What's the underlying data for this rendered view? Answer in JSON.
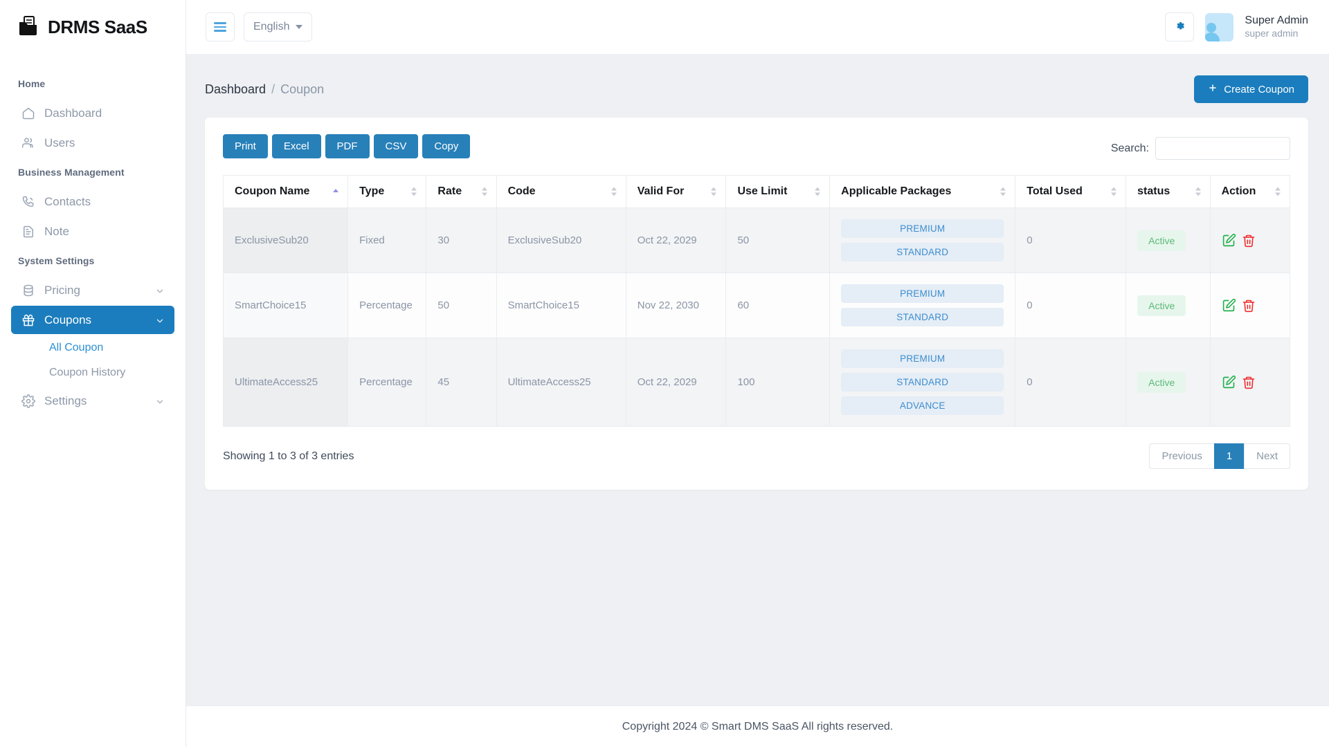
{
  "brand": {
    "name": "DRMS SaaS",
    "logo_icon": "documents-folder-icon"
  },
  "sidebar": {
    "sections": [
      {
        "title": "Home",
        "items": [
          {
            "label": "Dashboard",
            "icon": "home-icon",
            "expandable": false,
            "active": false
          },
          {
            "label": "Users",
            "icon": "users-icon",
            "expandable": false,
            "active": false
          }
        ]
      },
      {
        "title": "Business Management",
        "items": [
          {
            "label": "Contacts",
            "icon": "phone-icon",
            "expandable": false,
            "active": false
          },
          {
            "label": "Note",
            "icon": "note-icon",
            "expandable": false,
            "active": false
          }
        ]
      },
      {
        "title": "System Settings",
        "items": [
          {
            "label": "Pricing",
            "icon": "database-icon",
            "expandable": true,
            "active": false
          },
          {
            "label": "Coupons",
            "icon": "gift-icon",
            "expandable": true,
            "active": true,
            "children": [
              {
                "label": "All Coupon",
                "current": true
              },
              {
                "label": "Coupon History",
                "current": false
              }
            ]
          },
          {
            "label": "Settings",
            "icon": "gear-icon",
            "expandable": true,
            "active": false
          }
        ]
      }
    ]
  },
  "topbar": {
    "menu_toggle_icon": "hamburger-icon",
    "language": "English",
    "settings_icon": "gear-icon",
    "user": {
      "name": "Super Admin",
      "role": "super admin",
      "avatar_icon": "user-avatar-icon"
    }
  },
  "page": {
    "breadcrumb": {
      "root": "Dashboard",
      "separator": "/",
      "current": "Coupon"
    },
    "create_button": {
      "label": "Create Coupon",
      "icon": "plus-icon"
    }
  },
  "table_tools": {
    "export_buttons": [
      "Print",
      "Excel",
      "PDF",
      "CSV",
      "Copy"
    ],
    "search_label": "Search:",
    "search_value": "",
    "search_placeholder": ""
  },
  "table": {
    "columns": [
      {
        "label": "Coupon Name",
        "sorted": "asc"
      },
      {
        "label": "Type",
        "sorted": "none"
      },
      {
        "label": "Rate",
        "sorted": "none"
      },
      {
        "label": "Code",
        "sorted": "none"
      },
      {
        "label": "Valid For",
        "sorted": "none"
      },
      {
        "label": "Use Limit",
        "sorted": "none"
      },
      {
        "label": "Applicable Packages",
        "sorted": "none"
      },
      {
        "label": "Total Used",
        "sorted": "none"
      },
      {
        "label": "status",
        "sorted": "none"
      },
      {
        "label": "Action",
        "sorted": "none"
      }
    ],
    "rows": [
      {
        "coupon_name": "ExclusiveSub20",
        "type": "Fixed",
        "rate": "30",
        "code": "ExclusiveSub20",
        "valid_for": "Oct 22, 2029",
        "use_limit": "50",
        "packages": [
          "PREMIUM",
          "STANDARD"
        ],
        "total_used": "0",
        "status": "Active",
        "actions": [
          "edit-icon",
          "delete-icon"
        ]
      },
      {
        "coupon_name": "SmartChoice15",
        "type": "Percentage",
        "rate": "50",
        "code": "SmartChoice15",
        "valid_for": "Nov 22, 2030",
        "use_limit": "60",
        "packages": [
          "PREMIUM",
          "STANDARD"
        ],
        "total_used": "0",
        "status": "Active",
        "actions": [
          "edit-icon",
          "delete-icon"
        ]
      },
      {
        "coupon_name": "UltimateAccess25",
        "type": "Percentage",
        "rate": "45",
        "code": "UltimateAccess25",
        "valid_for": "Oct 22, 2029",
        "use_limit": "100",
        "packages": [
          "PREMIUM",
          "STANDARD",
          "ADVANCE"
        ],
        "total_used": "0",
        "status": "Active",
        "actions": [
          "edit-icon",
          "delete-icon"
        ]
      }
    ]
  },
  "pagination": {
    "entries_info": "Showing 1 to 3 of 3 entries",
    "previous": "Previous",
    "pages": [
      "1"
    ],
    "active_page": "1",
    "next": "Next"
  },
  "footer": {
    "text": "Copyright 2024 © Smart DMS SaaS All rights reserved."
  },
  "colors": {
    "accent": "#1b7dbd",
    "export_button": "#2880b9",
    "link": "#2a8fd4",
    "badge_bg": "#e5edf6",
    "badge_text": "#3c8dce",
    "status_bg": "#e7f6ec",
    "status_text": "#5cb979",
    "edit_icon": "#22b14c",
    "delete_icon": "#ee2b2b",
    "page_bg": "#eef0f3"
  }
}
